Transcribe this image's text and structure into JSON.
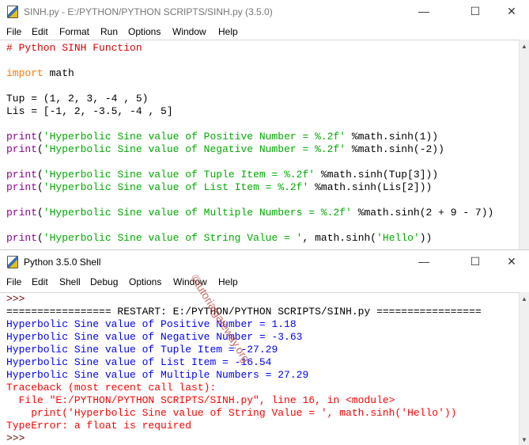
{
  "editor": {
    "title": "SINH.py - E:/PYTHON/PYTHON SCRIPTS/SINH.py (3.5.0)",
    "menu": [
      "File",
      "Edit",
      "Format",
      "Run",
      "Options",
      "Window",
      "Help"
    ],
    "lines": [
      [
        [
          "# Python SINH Function",
          "comment"
        ]
      ],
      [],
      [
        [
          "import",
          "keyword"
        ],
        [
          " math",
          "default"
        ]
      ],
      [],
      [
        [
          "Tup = (1, 2, 3, -4 , 5)",
          "default"
        ]
      ],
      [
        [
          "Lis = [-1, 2, -3.5, -4 , 5]",
          "default"
        ]
      ],
      [],
      [
        [
          "print",
          "builtin"
        ],
        [
          "(",
          "default"
        ],
        [
          "'Hyperbolic Sine value of Positive Number = %.2f'",
          "string"
        ],
        [
          " %math.sinh(1))",
          "default"
        ]
      ],
      [
        [
          "print",
          "builtin"
        ],
        [
          "(",
          "default"
        ],
        [
          "'Hyperbolic Sine value of Negative Number = %.2f'",
          "string"
        ],
        [
          " %math.sinh(-2))",
          "default"
        ]
      ],
      [],
      [
        [
          "print",
          "builtin"
        ],
        [
          "(",
          "default"
        ],
        [
          "'Hyperbolic Sine value of Tuple Item = %.2f'",
          "string"
        ],
        [
          " %math.sinh(Tup[3]))",
          "default"
        ]
      ],
      [
        [
          "print",
          "builtin"
        ],
        [
          "(",
          "default"
        ],
        [
          "'Hyperbolic Sine value of List Item = %.2f'",
          "string"
        ],
        [
          " %math.sinh(Lis[2]))",
          "default"
        ]
      ],
      [],
      [
        [
          "print",
          "builtin"
        ],
        [
          "(",
          "default"
        ],
        [
          "'Hyperbolic Sine value of Multiple Numbers = %.2f'",
          "string"
        ],
        [
          " %math.sinh(2 + 9 - 7))",
          "default"
        ]
      ],
      [],
      [
        [
          "print",
          "builtin"
        ],
        [
          "(",
          "default"
        ],
        [
          "'Hyperbolic Sine value of String Value = '",
          "string"
        ],
        [
          ", math.sinh(",
          "default"
        ],
        [
          "'Hello'",
          "string"
        ],
        [
          "))",
          "default"
        ]
      ]
    ]
  },
  "shell": {
    "title": "Python 3.5.0 Shell",
    "menu": [
      "File",
      "Edit",
      "Shell",
      "Debug",
      "Options",
      "Window",
      "Help"
    ],
    "lines": [
      [
        [
          ">>>",
          "prompt"
        ]
      ],
      [
        [
          "================= RESTART: E:/PYTHON/PYTHON SCRIPTS/SINH.py =================",
          "default"
        ]
      ],
      [
        [
          "Hyperbolic Sine value of Positive Number = 1.18",
          "output"
        ]
      ],
      [
        [
          "Hyperbolic Sine value of Negative Number = -3.63",
          "output"
        ]
      ],
      [
        [
          "Hyperbolic Sine value of Tuple Item = -27.29",
          "output"
        ]
      ],
      [
        [
          "Hyperbolic Sine value of List Item = -16.54",
          "output"
        ]
      ],
      [
        [
          "Hyperbolic Sine value of Multiple Numbers = 27.29",
          "output"
        ]
      ],
      [
        [
          "Traceback (most recent call last):",
          "error"
        ]
      ],
      [
        [
          "  File \"E:/PYTHON/PYTHON SCRIPTS/SINH.py\", line 16, in <module>",
          "error"
        ]
      ],
      [
        [
          "    print('Hyperbolic Sine value of String Value = ', math.sinh('Hello'))",
          "error"
        ]
      ],
      [
        [
          "TypeError: a float is required",
          "error"
        ]
      ],
      [
        [
          ">>>",
          "prompt"
        ]
      ]
    ]
  },
  "watermark": "©tutorialgateway.org"
}
